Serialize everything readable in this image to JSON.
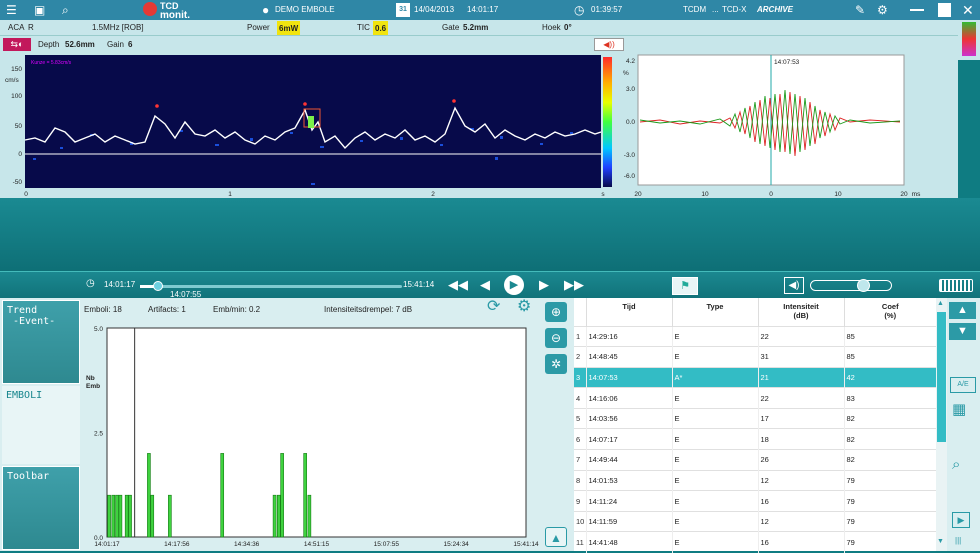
{
  "titlebar": {
    "logo_top": "TCD",
    "logo_bottom": "monit.",
    "patient": "DEMO EMBOLE",
    "date_day": "31",
    "date": "14/04/2013",
    "time": "14:01:17",
    "clock": "01:39:57",
    "mode1": "TCDM",
    "mode2": "TCD-X",
    "mode3": "ARCHIVE"
  },
  "info": {
    "vessel": "ACA",
    "side": "R",
    "probe": "1.5MHz [ROB]",
    "power_label": "Power",
    "power_value": "6mW",
    "tic_label": "TIC",
    "tic_value": "0.6",
    "gate_label": "Gate",
    "gate_value": "5.2mm",
    "angle_label": "Hoek",
    "angle_value": "0°"
  },
  "controls": {
    "depth_label": "Depth",
    "depth_value": "52.6mm",
    "gain_label": "Gain",
    "gain_value": "6"
  },
  "spectrum": {
    "scale_note": "Kunze = 5.83cm/s",
    "y_unit": "cm/s",
    "y_ticks": [
      "150",
      "100",
      "50",
      "0",
      "-50"
    ],
    "x_ticks": [
      "0",
      "1",
      "2"
    ],
    "x_unit": "s",
    "color_unit": "%",
    "color_ticks": [
      "4.2",
      "3.0",
      "0.0",
      "-3.0",
      "-6.0"
    ]
  },
  "waveform": {
    "time_marker": "14:07:53",
    "x_ticks": [
      "20",
      "10",
      "0",
      "10",
      "20"
    ],
    "x_unit": "ms"
  },
  "player": {
    "start_time": "14:01:17",
    "current_time": "14:07:55",
    "end_time": "15:41:14",
    "slider_fraction": 0.07
  },
  "nav": {
    "trend": "Trend",
    "event": "-Event-",
    "emboli": "EMBOLI",
    "toolbar": "Toolbar"
  },
  "embo_stats": {
    "emboli": "Emboli: 18",
    "artifacts": "Artifacts: 1",
    "rate": "Emb/min: 0.2",
    "threshold": "Intensiteitsdrempel: 7 dB"
  },
  "chart_data": {
    "type": "bar",
    "ylabel": "Nb Emb",
    "ylim": [
      0,
      5
    ],
    "y_ticks": [
      "5.0",
      "2.5",
      "0.0"
    ],
    "x_ticks": [
      "14:01:17",
      "14:17:56",
      "14:34:36",
      "14:51:15",
      "15:07:55",
      "15:24:34",
      "15:41:14"
    ],
    "x_range_min": [
      0,
      100
    ],
    "bars": [
      {
        "t": 0.5,
        "v": 1
      },
      {
        "t": 1.5,
        "v": 1
      },
      {
        "t": 2.4,
        "v": 1
      },
      {
        "t": 3.2,
        "v": 1
      },
      {
        "t": 4.7,
        "v": 1
      },
      {
        "t": 5.5,
        "v": 1
      },
      {
        "t": 10.0,
        "v": 2
      },
      {
        "t": 10.8,
        "v": 1
      },
      {
        "t": 15.0,
        "v": 1
      },
      {
        "t": 27.5,
        "v": 2
      },
      {
        "t": 40.0,
        "v": 1
      },
      {
        "t": 41.0,
        "v": 1
      },
      {
        "t": 41.8,
        "v": 2
      },
      {
        "t": 47.3,
        "v": 2
      },
      {
        "t": 48.3,
        "v": 1
      }
    ],
    "cursor_t": 6.6
  },
  "table": {
    "headers": [
      "Tijd",
      "Type",
      "Intensiteit\n(dB)",
      "Coef\n(%)"
    ],
    "rows": [
      [
        "1",
        "14:29:16",
        "E",
        "22",
        "85"
      ],
      [
        "2",
        "14:48:45",
        "E",
        "31",
        "85"
      ],
      [
        "3",
        "14:07:53",
        "A*",
        "21",
        "42"
      ],
      [
        "4",
        "14:16:06",
        "E",
        "22",
        "83"
      ],
      [
        "5",
        "14:03:56",
        "E",
        "17",
        "82"
      ],
      [
        "6",
        "14:07:17",
        "E",
        "18",
        "82"
      ],
      [
        "7",
        "14:49:44",
        "E",
        "26",
        "82"
      ],
      [
        "8",
        "14:01:53",
        "E",
        "12",
        "79"
      ],
      [
        "9",
        "14:11:24",
        "E",
        "16",
        "79"
      ],
      [
        "10",
        "14:11:59",
        "E",
        "12",
        "79"
      ],
      [
        "11",
        "14:41:48",
        "E",
        "16",
        "79"
      ]
    ],
    "selected_row": 2
  },
  "icons": {
    "ae": "A/E"
  }
}
